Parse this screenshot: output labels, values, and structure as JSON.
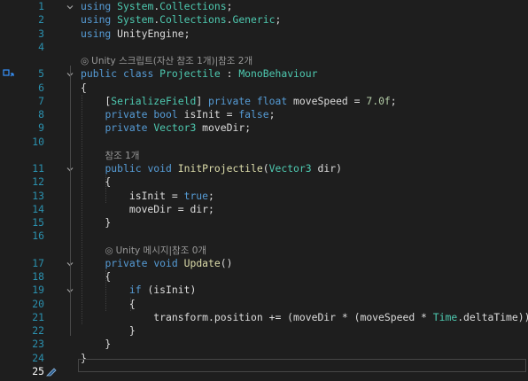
{
  "editor": {
    "lines": [
      {
        "n": "1",
        "tokens": [
          [
            "kw",
            "using"
          ],
          [
            "pun",
            " "
          ],
          [
            "ty",
            "System"
          ],
          [
            "pun",
            "."
          ],
          [
            "ty",
            "Collections"
          ],
          [
            "pun",
            ";"
          ]
        ]
      },
      {
        "n": "2",
        "tokens": [
          [
            "kw",
            "using"
          ],
          [
            "pun",
            " "
          ],
          [
            "ty",
            "System"
          ],
          [
            "pun",
            "."
          ],
          [
            "ty",
            "Collections"
          ],
          [
            "pun",
            "."
          ],
          [
            "ty",
            "Generic"
          ],
          [
            "pun",
            ";"
          ]
        ]
      },
      {
        "n": "3",
        "tokens": [
          [
            "kw",
            "using"
          ],
          [
            "pun",
            " UnityEngine;"
          ]
        ]
      },
      {
        "n": "4",
        "tokens": []
      },
      {
        "n": "",
        "lens": "Unity 스크립트(자산 참조 1개)|참조 2개",
        "indent": 0
      },
      {
        "n": "5",
        "tokens": [
          [
            "kw",
            "public"
          ],
          [
            "pun",
            " "
          ],
          [
            "kw",
            "class"
          ],
          [
            "pun",
            " "
          ],
          [
            "ty",
            "Projectile"
          ],
          [
            "pun",
            " : "
          ],
          [
            "ty",
            "MonoBehaviour"
          ]
        ]
      },
      {
        "n": "6",
        "tokens": [
          [
            "pun",
            "{"
          ]
        ]
      },
      {
        "n": "7",
        "tokens": [
          [
            "pun",
            "    ["
          ],
          [
            "attr",
            "SerializeField"
          ],
          [
            "pun",
            "] "
          ],
          [
            "kw",
            "private"
          ],
          [
            "pun",
            " "
          ],
          [
            "kw",
            "float"
          ],
          [
            "pun",
            " moveSpeed = "
          ],
          [
            "num",
            "7.0f"
          ],
          [
            "pun",
            ";"
          ]
        ]
      },
      {
        "n": "8",
        "tokens": [
          [
            "pun",
            "    "
          ],
          [
            "kw",
            "private"
          ],
          [
            "pun",
            " "
          ],
          [
            "kw",
            "bool"
          ],
          [
            "pun",
            " isInit = "
          ],
          [
            "kw",
            "false"
          ],
          [
            "pun",
            ";"
          ]
        ]
      },
      {
        "n": "9",
        "tokens": [
          [
            "pun",
            "    "
          ],
          [
            "kw",
            "private"
          ],
          [
            "pun",
            " "
          ],
          [
            "ty",
            "Vector3"
          ],
          [
            "pun",
            " moveDir;"
          ]
        ]
      },
      {
        "n": "10",
        "tokens": []
      },
      {
        "n": "",
        "lens": "참조 1개",
        "indent": 4
      },
      {
        "n": "11",
        "tokens": [
          [
            "pun",
            "    "
          ],
          [
            "kw",
            "public"
          ],
          [
            "pun",
            " "
          ],
          [
            "kw",
            "void"
          ],
          [
            "pun",
            " "
          ],
          [
            "mth",
            "InitProjectile"
          ],
          [
            "pun",
            "("
          ],
          [
            "ty",
            "Vector3"
          ],
          [
            "pun",
            " dir)"
          ]
        ]
      },
      {
        "n": "12",
        "tokens": [
          [
            "pun",
            "    {"
          ]
        ]
      },
      {
        "n": "13",
        "tokens": [
          [
            "pun",
            "        isInit = "
          ],
          [
            "kw",
            "true"
          ],
          [
            "pun",
            ";"
          ]
        ]
      },
      {
        "n": "14",
        "tokens": [
          [
            "pun",
            "        moveDir = dir;"
          ]
        ]
      },
      {
        "n": "15",
        "tokens": [
          [
            "pun",
            "    }"
          ]
        ]
      },
      {
        "n": "16",
        "tokens": []
      },
      {
        "n": "",
        "lens": "Unity 메시지|참조 0개",
        "indent": 4
      },
      {
        "n": "17",
        "tokens": [
          [
            "pun",
            "    "
          ],
          [
            "kw",
            "private"
          ],
          [
            "pun",
            " "
          ],
          [
            "kw",
            "void"
          ],
          [
            "pun",
            " "
          ],
          [
            "mth",
            "Update"
          ],
          [
            "pun",
            "()"
          ]
        ]
      },
      {
        "n": "18",
        "tokens": [
          [
            "pun",
            "    {"
          ]
        ]
      },
      {
        "n": "19",
        "tokens": [
          [
            "pun",
            "        "
          ],
          [
            "kw",
            "if"
          ],
          [
            "pun",
            " (isInit)"
          ]
        ]
      },
      {
        "n": "20",
        "tokens": [
          [
            "pun",
            "        {"
          ]
        ]
      },
      {
        "n": "21",
        "tokens": [
          [
            "pun",
            "            transform.position += (moveDir * (moveSpeed * "
          ],
          [
            "ty",
            "Time"
          ],
          [
            "pun",
            ".deltaTime));"
          ]
        ]
      },
      {
        "n": "22",
        "tokens": [
          [
            "pun",
            "        }"
          ]
        ]
      },
      {
        "n": "23",
        "tokens": [
          [
            "pun",
            "    }"
          ]
        ]
      },
      {
        "n": "24",
        "tokens": [
          [
            "pun",
            "}"
          ]
        ]
      },
      {
        "n": "25",
        "tokens": []
      }
    ],
    "folds_at": [
      "1",
      "5",
      "11",
      "17",
      "19"
    ],
    "current_line": "25",
    "colors": {
      "background": "#1e1e1e",
      "keyword": "#569cd6",
      "type": "#4ec9b0",
      "line_number": "#2b91af"
    }
  }
}
